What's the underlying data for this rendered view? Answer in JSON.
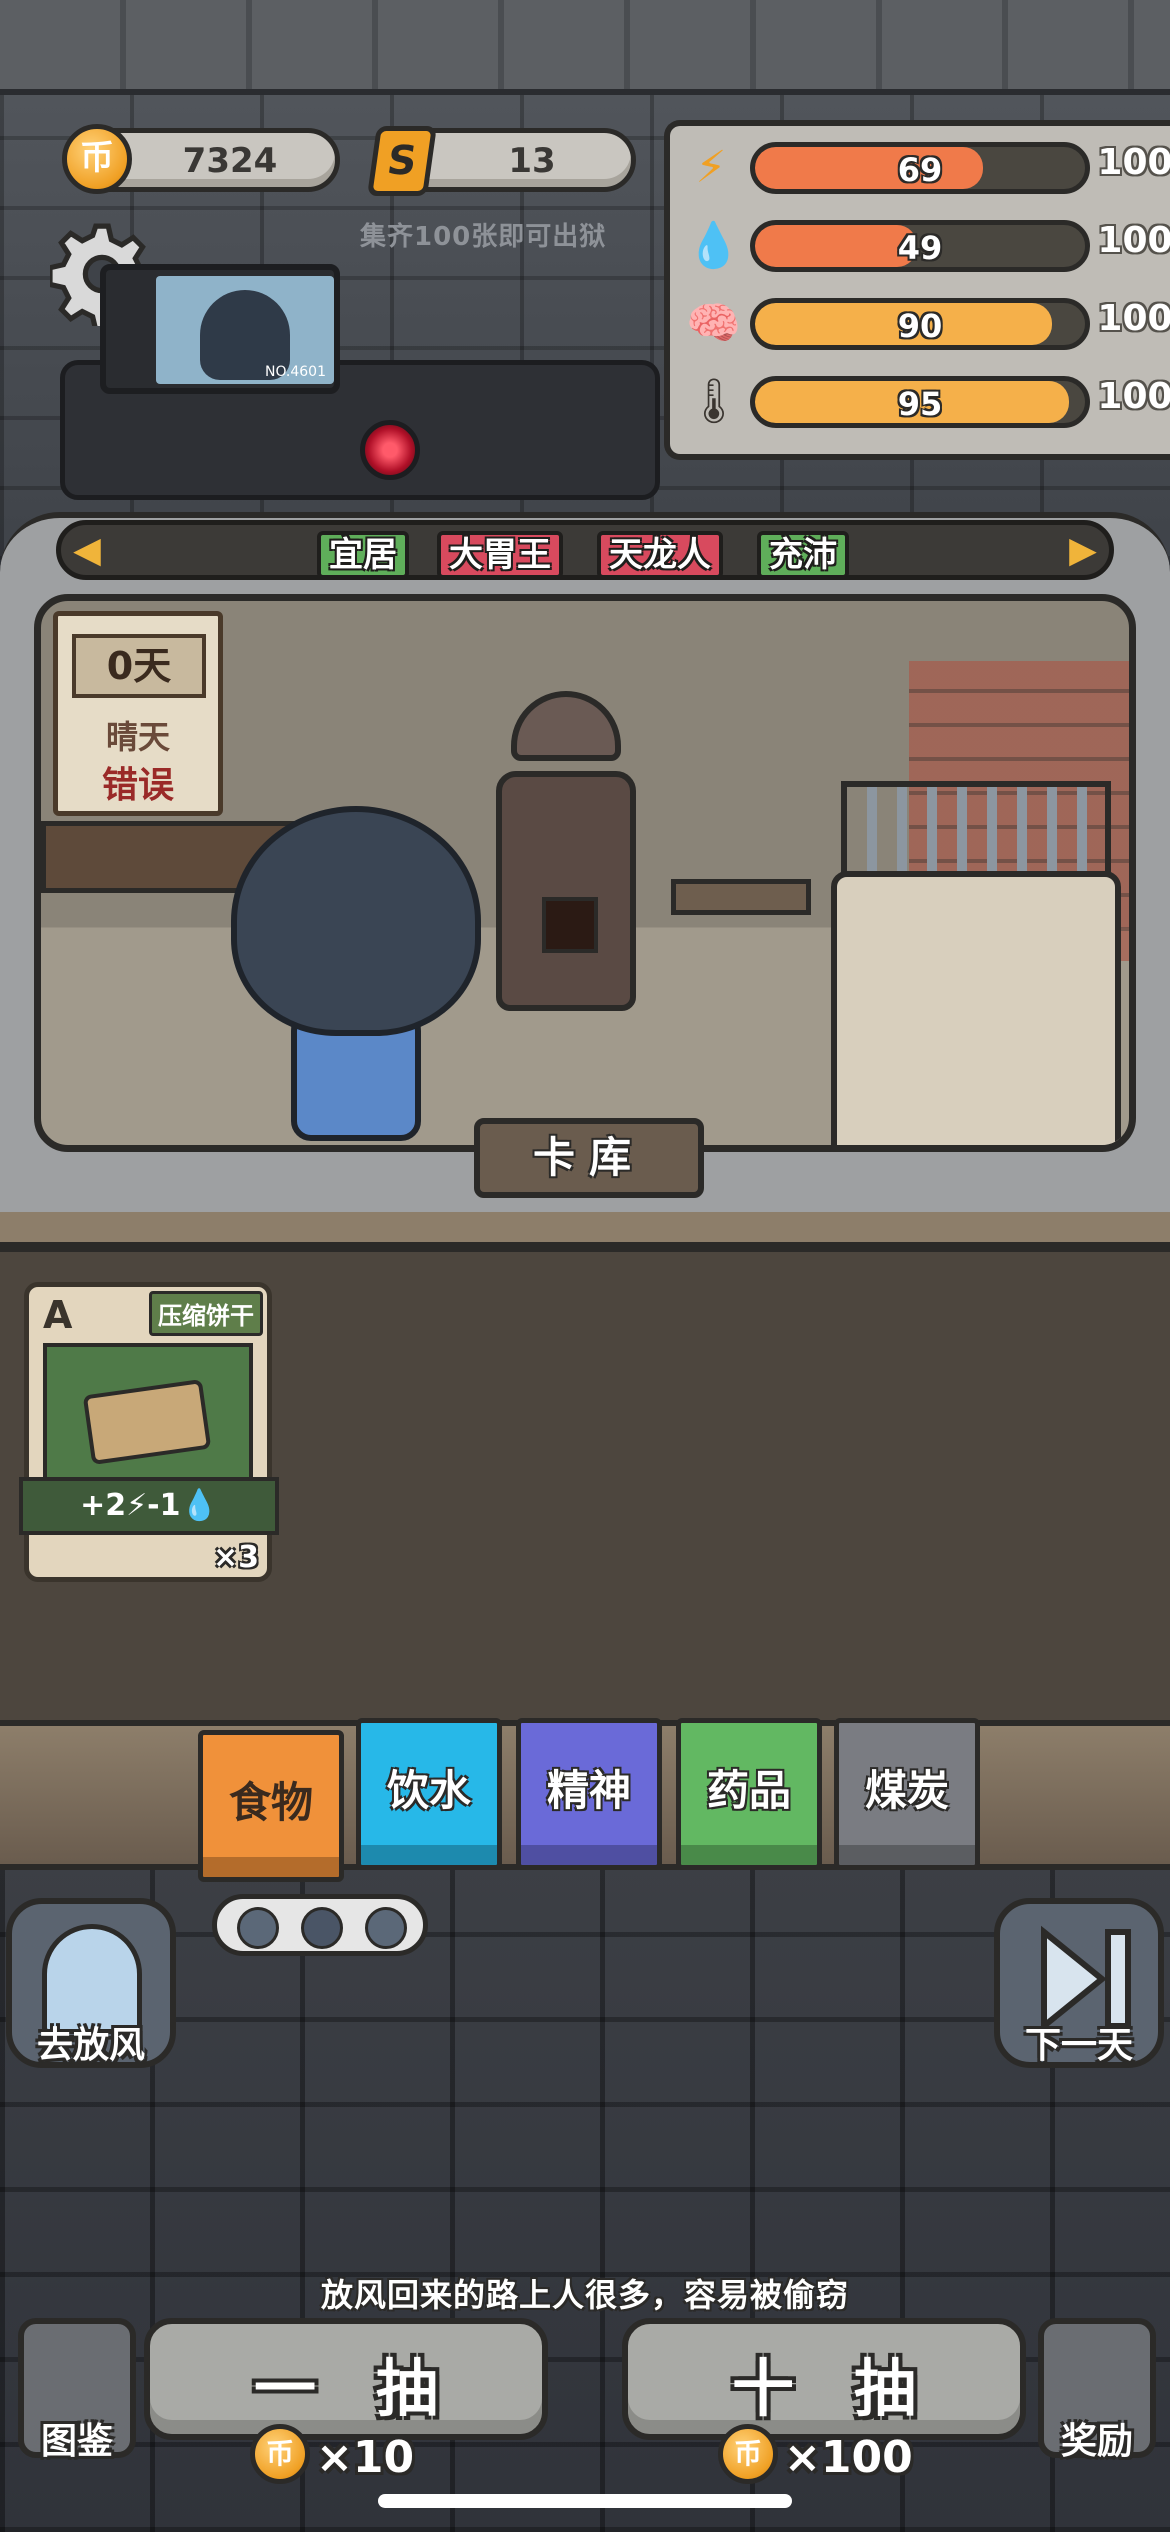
{
  "hud": {
    "coins": "7324",
    "coin_icon": "币",
    "tickets": "13",
    "ticket_icon": "S",
    "ticket_hint": "集齐100张即可出狱"
  },
  "monitor": {
    "id": "NO.4601"
  },
  "stats": [
    {
      "icon": "energy-icon",
      "glyph": "⚡",
      "value": "69",
      "max": "100",
      "fraction": 0.69,
      "color": "#f07a4a"
    },
    {
      "icon": "water-icon",
      "glyph": "💧",
      "value": "49",
      "max": "100",
      "fraction": 0.49,
      "color": "#f07a4a"
    },
    {
      "icon": "brain-icon",
      "glyph": "🧠",
      "value": "90",
      "max": "100",
      "fraction": 0.9,
      "color": "#f5b04a"
    },
    {
      "icon": "thermometer-icon",
      "glyph": "🌡",
      "value": "95",
      "max": "100",
      "fraction": 0.95,
      "color": "#f5b04a"
    }
  ],
  "traits": [
    {
      "label": "宜居",
      "color": "#5fae5a"
    },
    {
      "label": "大胃王",
      "color": "#d84a5e"
    },
    {
      "label": "天龙人",
      "color": "#d84a5e"
    },
    {
      "label": "充沛",
      "color": "#5fae5a"
    }
  ],
  "calendar": {
    "day": "0天",
    "weather": "晴天",
    "status": "错误"
  },
  "card_library_label": "卡库",
  "cards": [
    {
      "grade": "A",
      "name": "压缩饼干",
      "effect": "+2⚡-1💧",
      "count": "×3"
    }
  ],
  "categories": [
    {
      "label": "食物",
      "color": "#f0913a",
      "active": true
    },
    {
      "label": "饮水",
      "color": "#27b8e8",
      "active": false
    },
    {
      "label": "精神",
      "color": "#6a6ad8",
      "active": false
    },
    {
      "label": "药品",
      "color": "#62b862",
      "active": false
    },
    {
      "label": "煤炭",
      "color": "#7a7c82",
      "active": false
    }
  ],
  "actions": {
    "go_out_label": "去放风",
    "next_day_label": "下一天",
    "hint": "放风回来的路上人很多，容易被偷窃",
    "draw_one_label": "一抽",
    "draw_one_cost": "×10",
    "draw_ten_label": "十抽",
    "draw_ten_cost": "×100",
    "collection_label": "图鉴",
    "reward_label": "奖励"
  }
}
